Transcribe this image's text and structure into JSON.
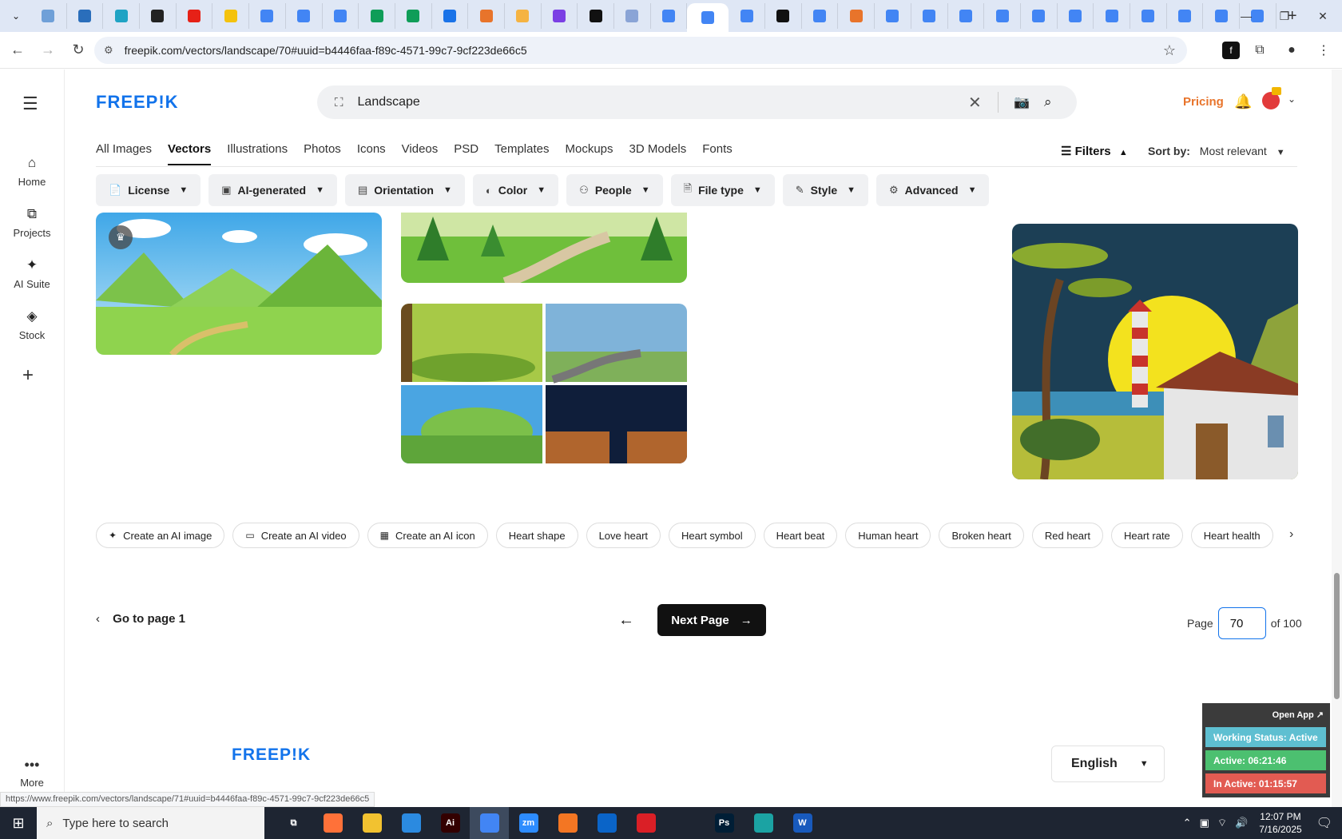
{
  "browser": {
    "tab_count_label": "",
    "active_tab_index": 18,
    "tab_favicons": [
      "#6fa0d8",
      "#2a6ebb",
      "#1fa3c4",
      "#222222",
      "#e62117",
      "#f4c20d",
      "#4285f4",
      "#4285f4",
      "#4285f4",
      "#0f9d58",
      "#0f9d58",
      "#1a73e8",
      "#e8742b",
      "#f5b342",
      "#7b3fe4",
      "#111111",
      "#8aa4d6",
      "#4285f4",
      "#4285f4",
      "#4285f4",
      "#111111",
      "#4285f4",
      "#e8742b",
      "#4285f4",
      "#4285f4",
      "#4285f4",
      "#4285f4",
      "#4285f4",
      "#4285f4",
      "#4285f4",
      "#4285f4",
      "#4285f4",
      "#4285f4",
      "#4285f4"
    ],
    "new_tab_label": "+",
    "url": "freepik.com/vectors/landscape/70#uuid=b4446faa-f89c-4571-99c7-9cf223de66c5",
    "status_url": "https://www.freepik.com/vectors/landscape/71#uuid=b4446faa-f89c-4571-99c7-9cf223de66c5"
  },
  "rail": {
    "items": [
      {
        "label": "Home",
        "icon": "home-icon"
      },
      {
        "label": "Projects",
        "icon": "projects-icon"
      },
      {
        "label": "AI Suite",
        "icon": "ai-suite-icon"
      },
      {
        "label": "Stock",
        "icon": "stock-icon"
      }
    ],
    "more_label": "More"
  },
  "header": {
    "logo": "FREEP!K",
    "search_value": "Landscape",
    "pricing_label": "Pricing"
  },
  "categories": {
    "tabs": [
      "All Images",
      "Vectors",
      "Illustrations",
      "Photos",
      "Icons",
      "Videos",
      "PSD",
      "Templates",
      "Mockups",
      "3D Models",
      "Fonts"
    ],
    "active": "Vectors",
    "filters_label": "Filters",
    "sort_label": "Sort by:",
    "sort_value": "Most relevant"
  },
  "filter_chips": [
    "License",
    "AI-generated",
    "Orientation",
    "Color",
    "People",
    "File type",
    "Style",
    "Advanced"
  ],
  "related_tags": {
    "ai_actions": [
      "Create an AI image",
      "Create an AI video",
      "Create an AI icon"
    ],
    "tags": [
      "Heart shape",
      "Love heart",
      "Heart symbol",
      "Heart beat",
      "Human heart",
      "Broken heart",
      "Red heart",
      "Heart rate",
      "Heart health"
    ]
  },
  "pagination": {
    "goto_label": "Go to page 1",
    "next_label": "Next Page",
    "page_label": "Page",
    "current_page": "70",
    "total_label": "of 100"
  },
  "footer": {
    "logo": "FREEP!K",
    "language": "English"
  },
  "widget": {
    "open_app": "Open App ↗",
    "working_status": "Working Status: Active",
    "active_time": "Active: 06:21:46",
    "inactive_time": "In Active: 01:15:57",
    "colors": {
      "status": "#5ebfd1",
      "active": "#4cc070",
      "inactive": "#e25b52"
    }
  },
  "taskbar": {
    "search_placeholder": "Type here to search",
    "time": "12:07 PM",
    "date": "7/16/2025",
    "apps": [
      {
        "name": "task-view-icon",
        "label": "⧉",
        "color": "transparent"
      },
      {
        "name": "firefox-icon",
        "label": "",
        "color": "#ff7139"
      },
      {
        "name": "file-explorer-icon",
        "label": "",
        "color": "#f2c230"
      },
      {
        "name": "vscode-icon",
        "label": "",
        "color": "#2b8ae0"
      },
      {
        "name": "illustrator-icon",
        "label": "Ai",
        "color": "#330000"
      },
      {
        "name": "chrome-icon",
        "label": "",
        "color": "#4285f4"
      },
      {
        "name": "zoom-icon",
        "label": "zm",
        "color": "#2d8cff"
      },
      {
        "name": "xampp-icon",
        "label": "",
        "color": "#f37623"
      },
      {
        "name": "outlook-icon",
        "label": "",
        "color": "#0a64c8"
      },
      {
        "name": "creative-cloud-icon",
        "label": "",
        "color": "#da1f26"
      },
      {
        "name": "pen-tool-icon",
        "label": "",
        "color": "transparent"
      },
      {
        "name": "photoshop-icon",
        "label": "Ps",
        "color": "#001e36"
      },
      {
        "name": "app-diamond-icon",
        "label": "",
        "color": "#1ba3a3"
      },
      {
        "name": "word-icon",
        "label": "W",
        "color": "#185abd"
      }
    ]
  }
}
